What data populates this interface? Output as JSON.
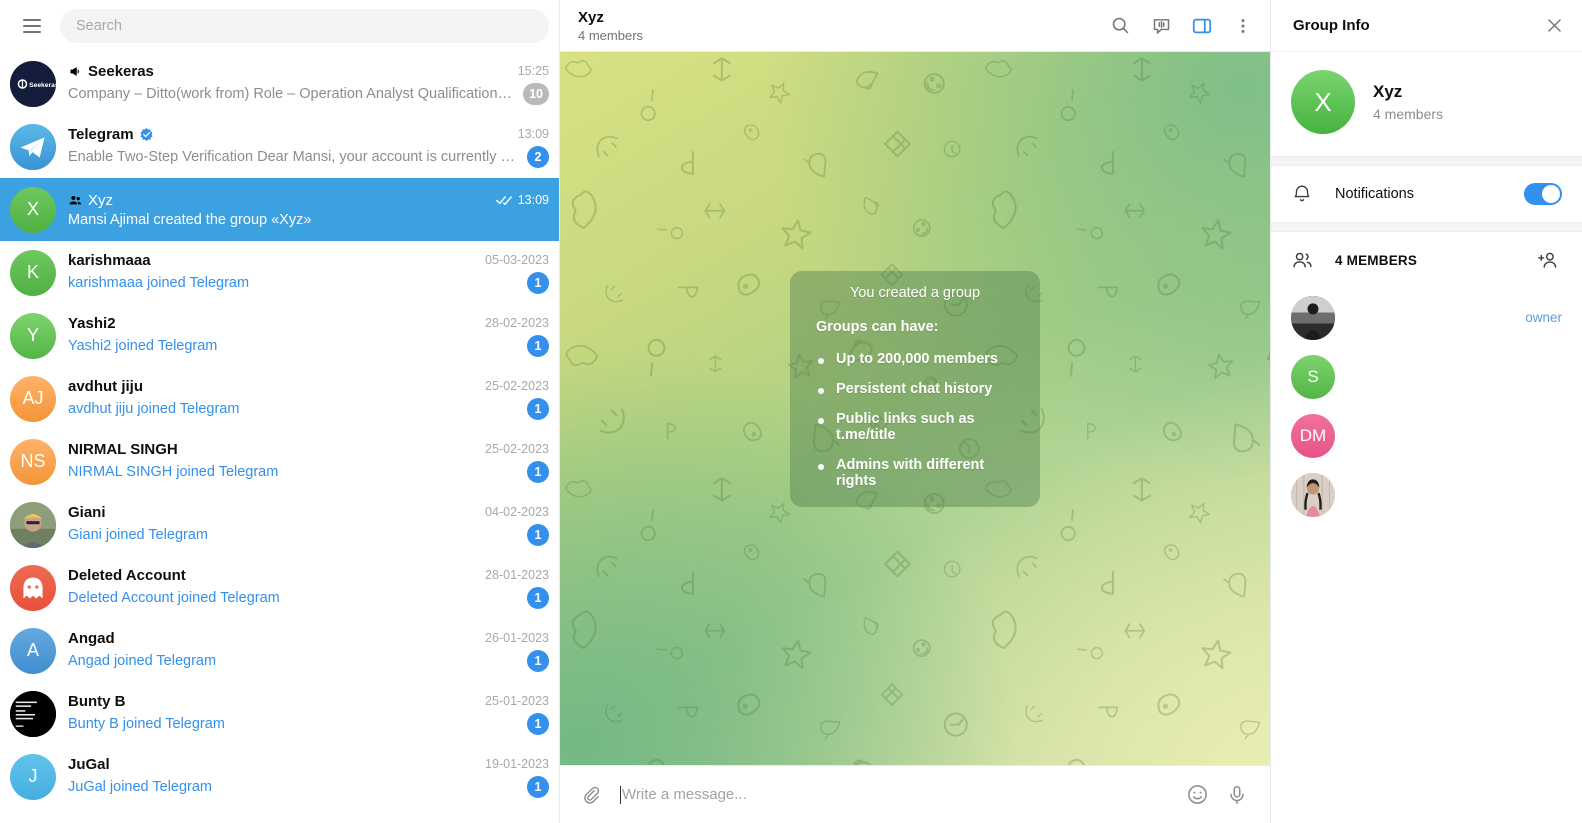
{
  "app": {
    "accent_color": "#3390ec",
    "selected_row_color": "#3ca1e0",
    "link_color": "#3390ec"
  },
  "left_panel": {
    "menu_icon": "hamburger-menu-icon",
    "search": {
      "placeholder": "Search",
      "value": ""
    },
    "chats": [
      {
        "id": "seekeras",
        "title": "Seekeras",
        "peer_type": "channel",
        "peer_icon": "megaphone-icon",
        "preview": "Company – Ditto(work from) Role – Operation Analyst Qualification – An…",
        "preview_style": "normal",
        "time": "15:25",
        "badge": "10",
        "badge_style": "muted",
        "avatar": {
          "type": "image",
          "kind": "logo-dark",
          "label": "Seekeras",
          "bg": "#141d3b"
        },
        "selected": false,
        "ticks": false
      },
      {
        "id": "telegram",
        "title": "Telegram",
        "peer_type": "service",
        "verified": true,
        "preview": "Enable Two-Step Verification Dear Mansi, your account is currently not p…",
        "preview_style": "normal",
        "time": "13:09",
        "badge": "2",
        "badge_style": "accent",
        "avatar": {
          "type": "image",
          "kind": "telegram-logo",
          "label": "",
          "bg": "#4aa3e0"
        },
        "selected": false,
        "ticks": false
      },
      {
        "id": "xyz",
        "title": "Xyz",
        "peer_type": "group",
        "peer_icon": "group-people-icon",
        "preview": "Mansi Ajimal created the group «Xyz»",
        "preview_style": "normal",
        "time": "13:09",
        "badge": "",
        "badge_style": "none",
        "avatar": {
          "type": "letter",
          "label": "X",
          "bg": "#6ec85f",
          "bg2": "#4fb043"
        },
        "selected": true,
        "ticks": true
      },
      {
        "id": "karishmaaa",
        "title": "karishmaaa",
        "peer_type": "user",
        "preview": "karishmaaa joined Telegram",
        "preview_style": "joined",
        "time": "05-03-2023",
        "badge": "1",
        "badge_style": "accent",
        "avatar": {
          "type": "letter",
          "label": "K",
          "bg": "#6ec85f",
          "bg2": "#4fb043"
        },
        "selected": false,
        "ticks": false
      },
      {
        "id": "yashi2",
        "title": "Yashi2",
        "peer_type": "user",
        "preview": "Yashi2 joined Telegram",
        "preview_style": "joined",
        "time": "28-02-2023",
        "badge": "1",
        "badge_style": "accent",
        "avatar": {
          "type": "letter",
          "label": "Y",
          "bg": "#7ed36d",
          "bg2": "#53b545"
        },
        "selected": false,
        "ticks": false
      },
      {
        "id": "avdhut-jiju",
        "title": "avdhut jiju",
        "peer_type": "user",
        "preview": "avdhut jiju joined Telegram",
        "preview_style": "joined",
        "time": "25-02-2023",
        "badge": "1",
        "badge_style": "accent",
        "avatar": {
          "type": "letter",
          "label": "AJ",
          "bg": "#ffb26b",
          "bg2": "#f29537"
        },
        "selected": false,
        "ticks": false
      },
      {
        "id": "nirmal-singh",
        "title": "NIRMAL SINGH",
        "peer_type": "user",
        "preview": "NIRMAL SINGH joined Telegram",
        "preview_style": "joined",
        "time": "25-02-2023",
        "badge": "1",
        "badge_style": "accent",
        "avatar": {
          "type": "letter",
          "label": "NS",
          "bg": "#ffb26b",
          "bg2": "#f29537"
        },
        "selected": false,
        "ticks": false
      },
      {
        "id": "giani",
        "title": "Giani",
        "peer_type": "user",
        "preview": "Giani joined Telegram",
        "preview_style": "joined",
        "time": "04-02-2023",
        "badge": "1",
        "badge_style": "accent",
        "avatar": {
          "type": "image",
          "kind": "photo-person-turban",
          "label": "",
          "bg": "#8a8f6c"
        },
        "selected": false,
        "ticks": false
      },
      {
        "id": "deleted-account",
        "title": "Deleted Account",
        "peer_type": "user",
        "preview": "Deleted Account joined Telegram",
        "preview_style": "joined",
        "time": "28-01-2023",
        "badge": "1",
        "badge_style": "accent",
        "avatar": {
          "type": "ghost",
          "label": "",
          "bg": "#ef6b52",
          "bg2": "#e8503a"
        },
        "selected": false,
        "ticks": false
      },
      {
        "id": "angad",
        "title": "Angad",
        "peer_type": "user",
        "preview": "Angad joined Telegram",
        "preview_style": "joined",
        "time": "26-01-2023",
        "badge": "1",
        "badge_style": "accent",
        "avatar": {
          "type": "letter",
          "label": "A",
          "bg": "#66a9e0",
          "bg2": "#3f8ed0"
        },
        "selected": false,
        "ticks": false
      },
      {
        "id": "bunty-b",
        "title": "Bunty B",
        "peer_type": "user",
        "preview": "Bunty B joined Telegram",
        "preview_style": "joined",
        "time": "25-01-2023",
        "badge": "1",
        "badge_style": "accent",
        "avatar": {
          "type": "image",
          "kind": "photo-black-text",
          "label": "",
          "bg": "#000000"
        },
        "selected": false,
        "ticks": false
      },
      {
        "id": "jugal",
        "title": "JuGal",
        "peer_type": "user",
        "preview": "JuGal joined Telegram",
        "preview_style": "joined",
        "time": "19-01-2023",
        "badge": "1",
        "badge_style": "accent",
        "avatar": {
          "type": "letter",
          "label": "J",
          "bg": "#62c2ea",
          "bg2": "#45afe0"
        },
        "selected": false,
        "ticks": false
      }
    ]
  },
  "chat_header": {
    "title": "Xyz",
    "subtitle": "4 members",
    "actions": [
      {
        "name": "search-icon",
        "label": "Search"
      },
      {
        "name": "voice-chat-icon",
        "label": "Voice chat"
      },
      {
        "name": "toggle-info-panel-icon",
        "label": "Group info",
        "active": true
      },
      {
        "name": "more-options-icon",
        "label": "More"
      }
    ]
  },
  "conversation": {
    "service_message": {
      "title": "You created a group",
      "subtitle": "Groups can have:",
      "bullets": [
        "Up to 200,000 members",
        "Persistent chat history",
        "Public links such as t.me/title",
        "Admins with different rights"
      ]
    }
  },
  "composer": {
    "attach_icon": "paperclip-icon",
    "placeholder": "Write a message...",
    "value": "",
    "emoji_icon": "smiley-icon",
    "voice_icon": "microphone-icon"
  },
  "right_panel": {
    "title": "Group Info",
    "close_icon": "close-icon",
    "profile": {
      "avatar_letter": "X",
      "name": "Xyz",
      "members": "4 members"
    },
    "notifications": {
      "icon": "bell-icon",
      "label": "Notifications",
      "enabled": true
    },
    "members_section": {
      "icon": "people-icon",
      "label": "4 MEMBERS",
      "add_icon": "add-member-icon"
    },
    "members": [
      {
        "name": "",
        "status": "",
        "role": "owner",
        "avatar": {
          "type": "image",
          "kind": "photo-bw-person",
          "label": "",
          "bg": "#3a3a3a"
        }
      },
      {
        "name": "",
        "status": "",
        "role": "",
        "avatar": {
          "type": "letter",
          "label": "S",
          "bg": "#7ed36d",
          "bg2": "#53b545"
        }
      },
      {
        "name": "",
        "status": "",
        "role": "",
        "avatar": {
          "type": "letter",
          "label": "DM",
          "bg": "#f0729a",
          "bg2": "#e8538a"
        }
      },
      {
        "name": "",
        "status": "",
        "role": "",
        "avatar": {
          "type": "image",
          "kind": "photo-person-pink",
          "label": "",
          "bg": "#cfa9a0"
        }
      }
    ]
  }
}
